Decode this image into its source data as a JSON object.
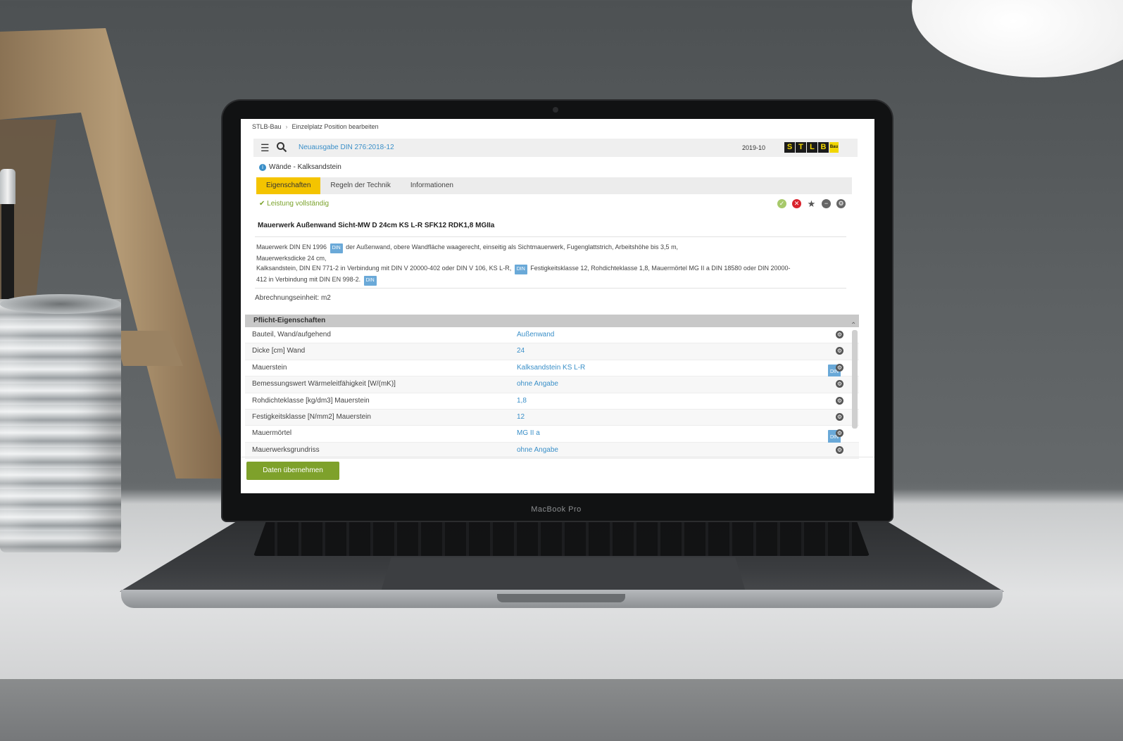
{
  "breadcrumb": {
    "app": "STLB-Bau",
    "separator": "›",
    "page": "Einzelplatz Position bearbeiten"
  },
  "topbar": {
    "edition_link": "Neuausgabe DIN 276:2018-12",
    "version": "2019-10",
    "logo_letters": [
      "S",
      "T",
      "L",
      "B",
      "Bau"
    ]
  },
  "section": {
    "label": "Wände - Kalksandstein"
  },
  "tabs": [
    {
      "label": "Eigenschaften",
      "active": true
    },
    {
      "label": "Regeln der Technik",
      "active": false
    },
    {
      "label": "Informationen",
      "active": false
    }
  ],
  "status": {
    "text": "Leistung vollständig"
  },
  "position": {
    "title": "Mauerwerk Außenwand Sicht-MW D 24cm KS L-R SFK12 RDK1,8 MGIIa",
    "desc_line1": "Mauerwerk DIN EN 1996",
    "desc_line1b": "der Außenwand, obere Wandfläche waagerecht, einseitig als Sichtmauerwerk, Fugenglattstrich, Arbeitshöhe bis 3,5 m,",
    "desc_line2": "Mauerwerksdicke 24 cm,",
    "desc_line3": "Kalksandstein, DIN EN 771-2 in Verbindung mit DIN V 20000-402 oder DIN V 106, KS L-R,",
    "desc_line3b": "Festigkeitsklasse 12, Rohdichteklasse 1,8, Mauermörtel MG II a DIN 18580 oder DIN 20000-",
    "desc_line4": "412 in Verbindung mit DIN EN 998-2.",
    "din_badge": "DIN",
    "unit": "Abrechnungseinheit: m2"
  },
  "properties": {
    "header": "Pflicht-Eigenschaften",
    "rows": [
      {
        "key": "Bauteil, Wand/aufgehend",
        "value": "Außenwand",
        "din": ""
      },
      {
        "key": "Dicke [cm] Wand",
        "value": "24",
        "din": ""
      },
      {
        "key": "Mauerstein",
        "value": "Kalksandstein KS L-R",
        "din": "DIN"
      },
      {
        "key": "Bemessungswert Wärmeleitfähigkeit [W/(mK)]",
        "value": "ohne Angabe",
        "din": ""
      },
      {
        "key": "Rohdichteklasse [kg/dm3] Mauerstein",
        "value": "1,8",
        "din": ""
      },
      {
        "key": "Festigkeitsklasse [N/mm2] Mauerstein",
        "value": "12",
        "din": ""
      },
      {
        "key": "Mauermörtel",
        "value": "MG II a",
        "din": "DIN"
      },
      {
        "key": "Mauerwerksgrundriss",
        "value": "ohne Angabe",
        "din": ""
      }
    ]
  },
  "footer": {
    "apply_label": "Daten übernehmen"
  },
  "device": {
    "brand": "MacBook Pro"
  },
  "colors": {
    "accent_yellow": "#f4c400",
    "link_blue": "#3a8fc8",
    "apply_green": "#7ea12b",
    "status_green": "#7aa22a"
  }
}
